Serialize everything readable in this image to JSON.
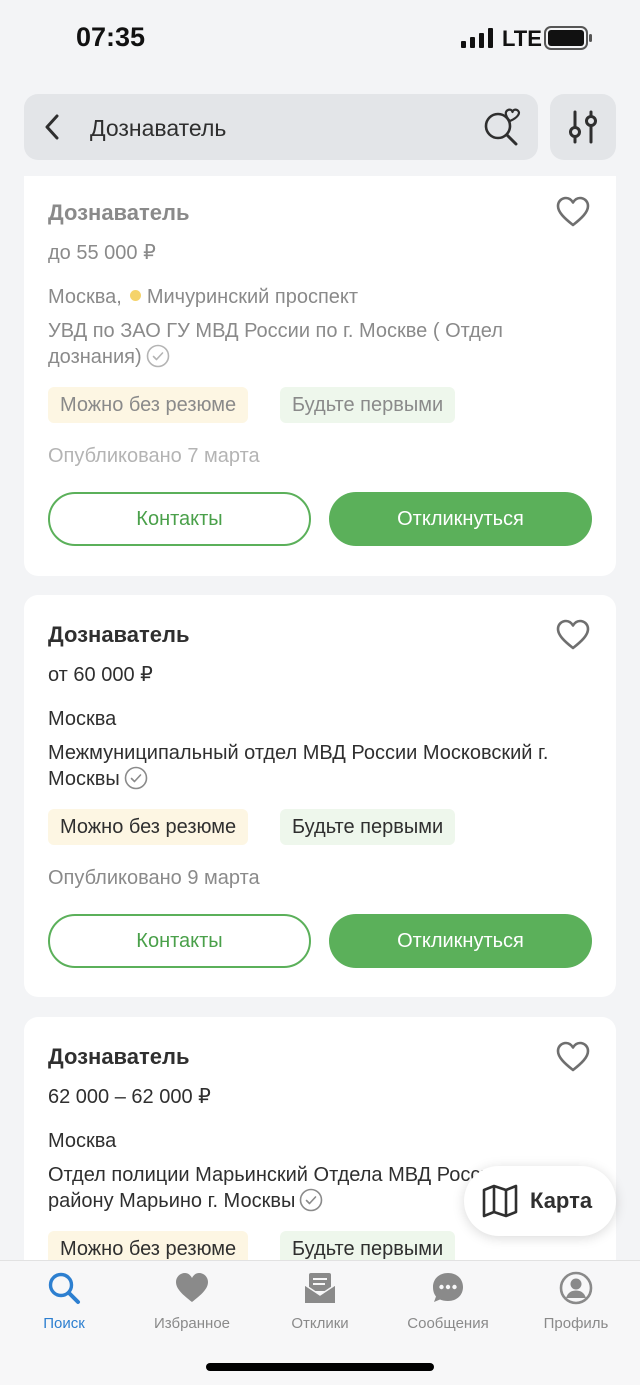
{
  "status_bar": {
    "time": "07:35",
    "network": "LTE"
  },
  "search": {
    "query": "Дознаватель"
  },
  "vacancies": [
    {
      "title": "Дознаватель",
      "salary": "до 55 000 ₽",
      "city": "Москва,",
      "metro": "Мичуринский проспект",
      "company": "УВД по ЗАО ГУ МВД России по г. Москве ( Отдел дознания)",
      "tags": [
        "Можно без резюме",
        "Будьте первыми"
      ],
      "published": "Опубликовано 7 марта",
      "contacts_label": "Контакты",
      "apply_label": "Откликнуться"
    },
    {
      "title": "Дознаватель",
      "salary": "от 60 000 ₽",
      "city": "Москва",
      "company": "Межмуниципальный отдел МВД России Московский г. Москвы",
      "tags": [
        "Можно без резюме",
        "Будьте первыми"
      ],
      "published": "Опубликовано 9 марта",
      "contacts_label": "Контакты",
      "apply_label": "Откликнуться"
    },
    {
      "title": "Дознаватель",
      "salary": "62 000 – 62 000 ₽",
      "city": "Москва",
      "company": "Отдел полиции Марьинский Отдела МВД России по району Марьино г. Москвы",
      "tags": [
        "Можно без резюме",
        "Будьте первыми"
      ]
    }
  ],
  "map_button": {
    "label": "Карта"
  },
  "tabs": [
    {
      "label": "Поиск",
      "icon": "search-icon",
      "active": true
    },
    {
      "label": "Избранное",
      "icon": "heart-icon"
    },
    {
      "label": "Отклики",
      "icon": "responses-icon"
    },
    {
      "label": "Сообщения",
      "icon": "messages-icon"
    },
    {
      "label": "Профиль",
      "icon": "profile-icon"
    }
  ],
  "colors": {
    "accent_green": "#5bb05a",
    "active_tab_blue": "#2d7fd0",
    "metro_dot": "#f5d36a"
  }
}
